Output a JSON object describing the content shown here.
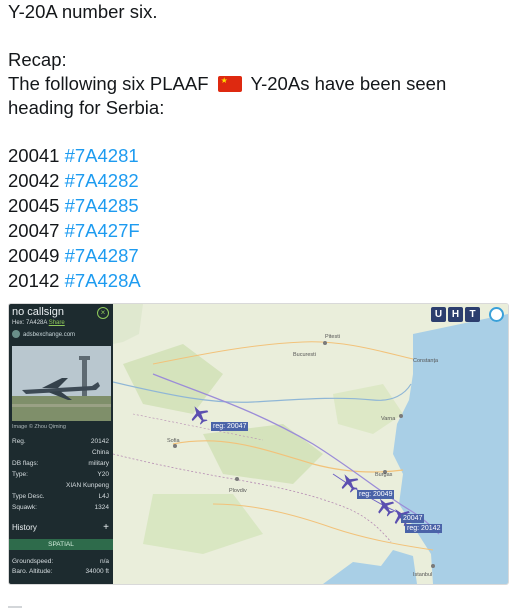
{
  "tweet": {
    "line1": "Y-20A number six.",
    "recap": "Recap:",
    "sentence_a": "The following six PLAAF",
    "sentence_b": "Y-20As have been seen",
    "sentence_c": "heading for Serbia:",
    "flag": "china-flag-emoji",
    "aircraft": [
      {
        "reg": "20041",
        "hex": "#7A4281"
      },
      {
        "reg": "20042",
        "hex": "#7A4282"
      },
      {
        "reg": "20045",
        "hex": "#7A4285"
      },
      {
        "reg": "20047",
        "hex": "#7A427F"
      },
      {
        "reg": "20049",
        "hex": "#7A4287"
      },
      {
        "reg": "20142",
        "hex": "#7A428A"
      }
    ],
    "hashtag_color": "#1d9bf0"
  },
  "tracker": {
    "panel": {
      "callsign": "no callsign",
      "hex_label": "Hex:",
      "hex_value": "7A428A",
      "share": "Share",
      "site": "adsbexchange.com",
      "image_credit": "Image © Zhou Qiming",
      "fields": [
        {
          "k": "Reg.",
          "v": "20142"
        },
        {
          "k": "",
          "v": "China"
        },
        {
          "k": "DB flags:",
          "v": "military"
        },
        {
          "k": "Type:",
          "v": "Y20"
        },
        {
          "k": "",
          "v": "XIAN Kunpeng"
        },
        {
          "k": "Type Desc.",
          "v": "L4J"
        },
        {
          "k": "Squawk:",
          "v": "1324"
        }
      ],
      "history": "History",
      "spatial": "SPATIAL",
      "bottom": [
        {
          "k": "Groundspeed:",
          "v": "n/a"
        },
        {
          "k": "Baro. Altitude:",
          "v": "34000 ft"
        }
      ]
    },
    "map": {
      "buttons": [
        "U",
        "H",
        "T"
      ],
      "labels": {
        "pl1": "reg: 20047",
        "pl2": "reg: 20049",
        "pl3": "20047",
        "pl4": "reg: 20142"
      },
      "places": [
        "Pitesti",
        "Bucuresti",
        "Constanța",
        "Varna",
        "Burgas",
        "Sofia",
        "Plovdiv",
        "Istanbul"
      ],
      "sea_color": "#a9cfe6",
      "land_color": "#e9ecd9",
      "plane_color": "#5b4fb0"
    }
  }
}
